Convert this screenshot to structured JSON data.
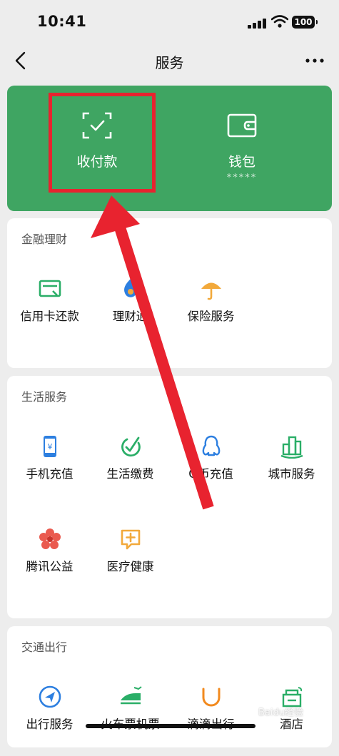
{
  "status_bar": {
    "time": "10:41",
    "battery": "100"
  },
  "nav": {
    "title": "服务"
  },
  "top_panel": {
    "receive_pay_label": "收付款",
    "wallet_label": "钱包",
    "wallet_balance": "*****"
  },
  "sections": {
    "finance": {
      "title": "金融理财",
      "items": [
        "信用卡还款",
        "理财通",
        "保险服务"
      ]
    },
    "life": {
      "title": "生活服务",
      "items": [
        "手机充值",
        "生活缴费",
        "Q币充值",
        "城市服务",
        "腾讯公益",
        "医疗健康"
      ]
    },
    "travel": {
      "title": "交通出行",
      "items": [
        "出行服务",
        "火车票机票",
        "滴滴出行",
        "酒店"
      ]
    }
  },
  "watermark": "Baidu经验",
  "colors": {
    "green_panel": "#3fa562",
    "annotation_red": "#e8232f"
  },
  "icons": {
    "finance": [
      "credit-card-icon",
      "wealth-icon",
      "umbrella-icon"
    ],
    "life": [
      "phone-yuan-icon",
      "checkmark-leaf-icon",
      "penguin-icon",
      "city-buildings-icon",
      "flower-icon",
      "medical-plus-icon"
    ],
    "travel": [
      "navigation-icon",
      "train-plane-icon",
      "didi-icon",
      "hotel-icon"
    ]
  }
}
